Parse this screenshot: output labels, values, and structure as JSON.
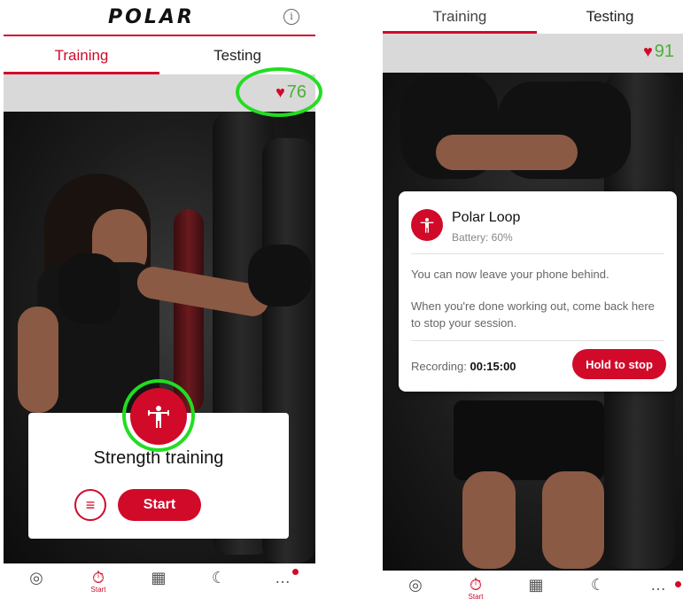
{
  "screen1": {
    "logo": "POLAR",
    "info_icon": "info-icon",
    "tabs": [
      {
        "label": "Training",
        "active": true
      },
      {
        "label": "Testing",
        "active": false
      }
    ],
    "heart_rate": "76",
    "training": {
      "title": "Strength training",
      "start_label": "Start",
      "menu_icon": "menu-icon",
      "icon": "dumbbell-person-icon"
    },
    "nav": [
      {
        "icon": "activity-icon"
      },
      {
        "icon": "stopwatch-icon",
        "label": "Start",
        "active": true
      },
      {
        "icon": "calendar-icon"
      },
      {
        "icon": "moon-icon"
      },
      {
        "icon": "more-icon"
      }
    ]
  },
  "screen2": {
    "tabs": [
      {
        "label": "Training",
        "active": true
      },
      {
        "label": "Testing",
        "active": false
      }
    ],
    "heart_rate": "91",
    "device": {
      "name": "Polar Loop",
      "battery": "Battery: 60%",
      "message1": "You can now leave your phone behind.",
      "message2": "When you're done working out, come back here to stop your session.",
      "recording_label": "Recording:",
      "recording_time": "00:15:00",
      "hold_label": "Hold to stop"
    },
    "nav": [
      {
        "icon": "activity-icon"
      },
      {
        "icon": "stopwatch-icon",
        "label": "Start",
        "active": true
      },
      {
        "icon": "calendar-icon"
      },
      {
        "icon": "moon-icon"
      },
      {
        "icon": "more-icon"
      }
    ]
  },
  "colors": {
    "accent": "#d10a2a",
    "hr_green": "#4caf3a",
    "highlight": "#22dd22"
  }
}
